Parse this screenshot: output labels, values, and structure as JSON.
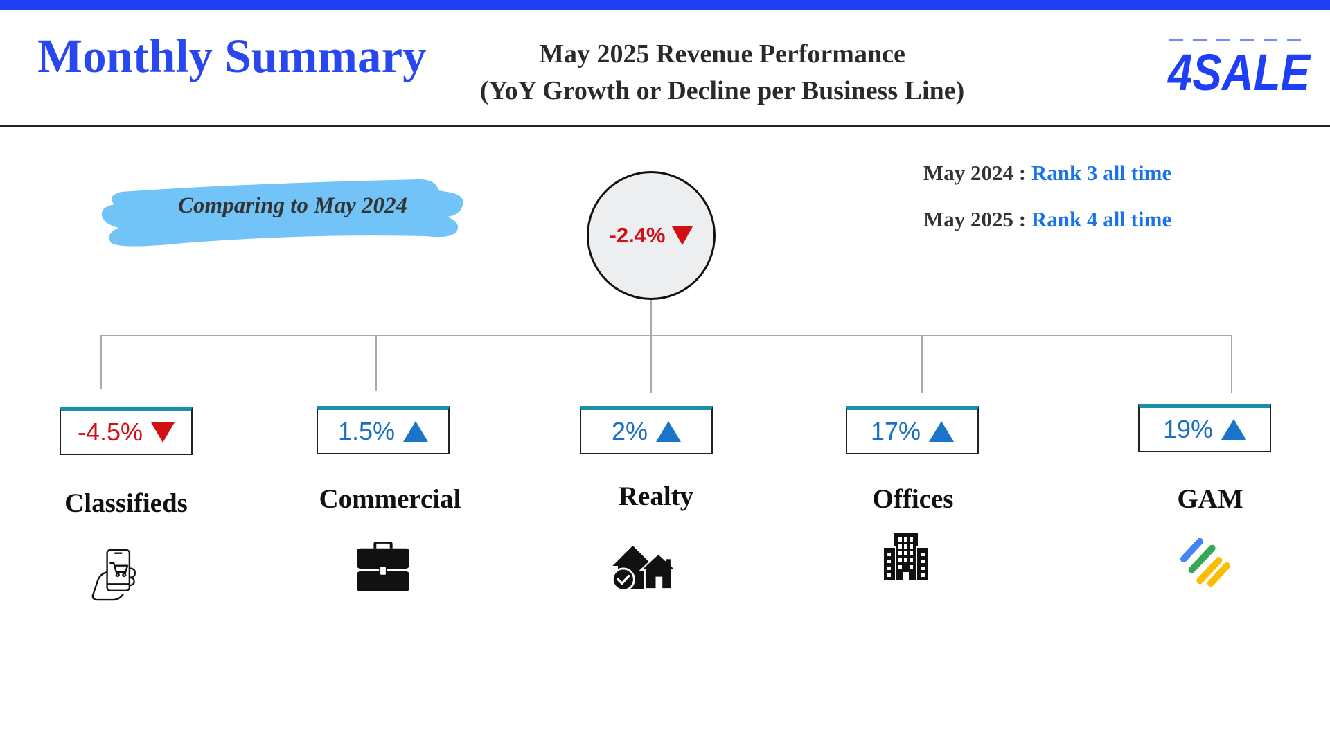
{
  "header": {
    "title": "Monthly Summary",
    "subtitle_line1": "May 2025 Revenue Performance",
    "subtitle_line2": "(YoY Growth or Decline per Business Line)",
    "logo_text": "4SALE"
  },
  "comparison_label": "Comparing to May 2024",
  "overall": {
    "value": "-2.4%",
    "direction": "down"
  },
  "ranks": [
    {
      "period": "May 2024 : ",
      "rank": "Rank 3 all time"
    },
    {
      "period": "May 2025 : ",
      "rank": "Rank 4 all time"
    }
  ],
  "business_lines": [
    {
      "name": "Classifieds",
      "value": "-4.5%",
      "direction": "down",
      "icon": "phone-shopping-cart-icon"
    },
    {
      "name": "Commercial",
      "value": "1.5%",
      "direction": "up",
      "icon": "briefcase-icon"
    },
    {
      "name": "Realty",
      "value": "2%",
      "direction": "up",
      "icon": "houses-icon"
    },
    {
      "name": "Offices",
      "value": "17%",
      "direction": "up",
      "icon": "office-building-icon"
    },
    {
      "name": "GAM",
      "value": "19%",
      "direction": "up",
      "icon": "google-ad-manager-icon"
    }
  ],
  "colors": {
    "brand_blue": "#1f3ff5",
    "title_blue": "#2947ef",
    "negative_red": "#d10f15",
    "positive_blue": "#1a6fc0",
    "box_top_teal": "#1b8fa8",
    "rank_blue": "#1a73e8",
    "brush_blue": "#72c3f7"
  }
}
